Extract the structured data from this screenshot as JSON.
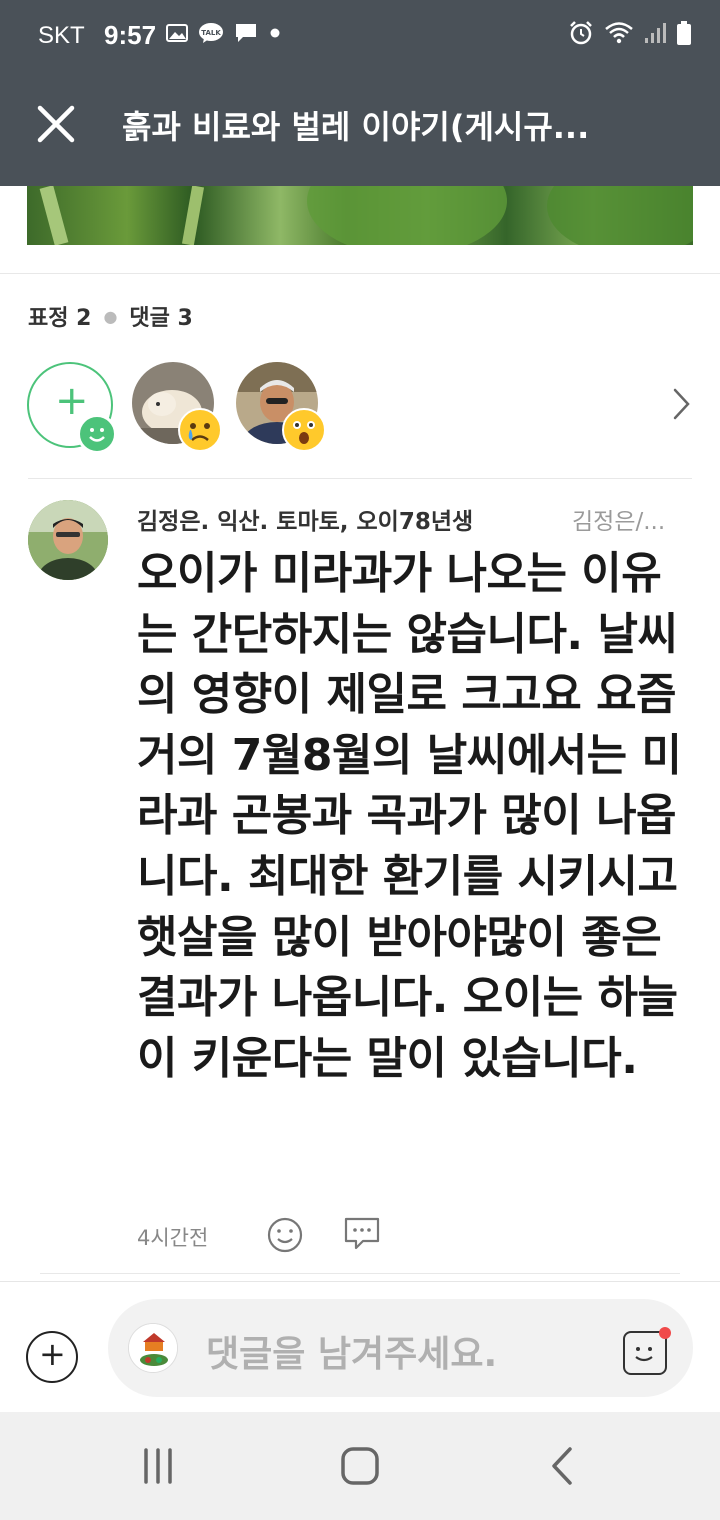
{
  "status_bar": {
    "carrier": "SKT",
    "time": "9:57",
    "icons_left": [
      "image-icon",
      "talk-icon",
      "chat-icon",
      "dot-icon"
    ],
    "icons_right": [
      "alarm-icon",
      "wifi-icon",
      "signal-icon",
      "battery-icon"
    ]
  },
  "header": {
    "title": "흙과 비료와 벌레 이야기(게시규...",
    "close_icon": "close-icon"
  },
  "reactions_summary": {
    "emotion_label": "표정 2",
    "comment_label": "댓글 3"
  },
  "reaction_emojis": [
    "crying-face-emoji",
    "surprised-face-emoji"
  ],
  "comment": {
    "author": "김정은. 익산. 토마토, 오이78년생",
    "author_sub": "김정은/...",
    "body": "오이가 미라과가 나오는 이유는 간단하지는 않습니다. 날씨의 영향이 제일로 크고요 요즘 거의 7월8월의 날씨에서는 미라과 곤봉과 곡과가 많이 나옵니다. 최대한 환기를 시키시고 햇살을 많이 받아야많이 좋은 결과가 나옵니다. 오이는 하늘이 키운다는 말이 있습니다.",
    "time": "4시간전"
  },
  "input": {
    "placeholder": "댓글을 남겨주세요."
  },
  "colors": {
    "header_bg": "#4a5158",
    "accent_green": "#4cc37a",
    "notification_red": "#f04a4a"
  }
}
